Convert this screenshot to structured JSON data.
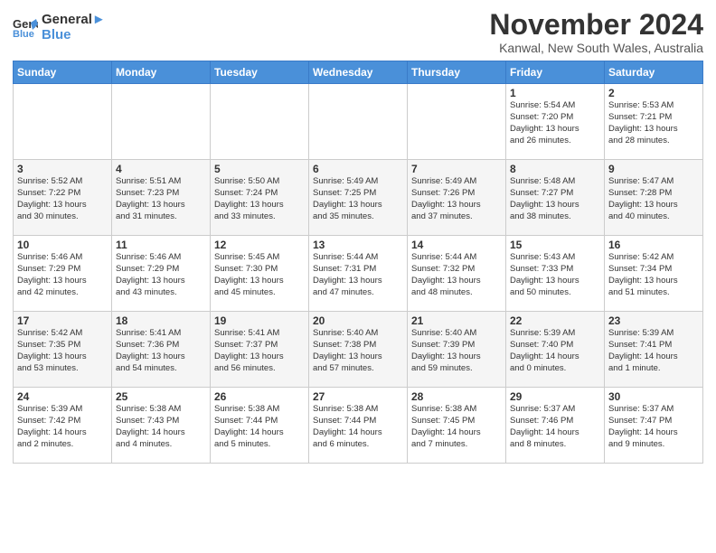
{
  "header": {
    "logo_line1": "General",
    "logo_line2": "Blue",
    "month_title": "November 2024",
    "location": "Kanwal, New South Wales, Australia"
  },
  "days_of_week": [
    "Sunday",
    "Monday",
    "Tuesday",
    "Wednesday",
    "Thursday",
    "Friday",
    "Saturday"
  ],
  "weeks": [
    [
      {
        "day": "",
        "info": ""
      },
      {
        "day": "",
        "info": ""
      },
      {
        "day": "",
        "info": ""
      },
      {
        "day": "",
        "info": ""
      },
      {
        "day": "",
        "info": ""
      },
      {
        "day": "1",
        "info": "Sunrise: 5:54 AM\nSunset: 7:20 PM\nDaylight: 13 hours\nand 26 minutes."
      },
      {
        "day": "2",
        "info": "Sunrise: 5:53 AM\nSunset: 7:21 PM\nDaylight: 13 hours\nand 28 minutes."
      }
    ],
    [
      {
        "day": "3",
        "info": "Sunrise: 5:52 AM\nSunset: 7:22 PM\nDaylight: 13 hours\nand 30 minutes."
      },
      {
        "day": "4",
        "info": "Sunrise: 5:51 AM\nSunset: 7:23 PM\nDaylight: 13 hours\nand 31 minutes."
      },
      {
        "day": "5",
        "info": "Sunrise: 5:50 AM\nSunset: 7:24 PM\nDaylight: 13 hours\nand 33 minutes."
      },
      {
        "day": "6",
        "info": "Sunrise: 5:49 AM\nSunset: 7:25 PM\nDaylight: 13 hours\nand 35 minutes."
      },
      {
        "day": "7",
        "info": "Sunrise: 5:49 AM\nSunset: 7:26 PM\nDaylight: 13 hours\nand 37 minutes."
      },
      {
        "day": "8",
        "info": "Sunrise: 5:48 AM\nSunset: 7:27 PM\nDaylight: 13 hours\nand 38 minutes."
      },
      {
        "day": "9",
        "info": "Sunrise: 5:47 AM\nSunset: 7:28 PM\nDaylight: 13 hours\nand 40 minutes."
      }
    ],
    [
      {
        "day": "10",
        "info": "Sunrise: 5:46 AM\nSunset: 7:29 PM\nDaylight: 13 hours\nand 42 minutes."
      },
      {
        "day": "11",
        "info": "Sunrise: 5:46 AM\nSunset: 7:29 PM\nDaylight: 13 hours\nand 43 minutes."
      },
      {
        "day": "12",
        "info": "Sunrise: 5:45 AM\nSunset: 7:30 PM\nDaylight: 13 hours\nand 45 minutes."
      },
      {
        "day": "13",
        "info": "Sunrise: 5:44 AM\nSunset: 7:31 PM\nDaylight: 13 hours\nand 47 minutes."
      },
      {
        "day": "14",
        "info": "Sunrise: 5:44 AM\nSunset: 7:32 PM\nDaylight: 13 hours\nand 48 minutes."
      },
      {
        "day": "15",
        "info": "Sunrise: 5:43 AM\nSunset: 7:33 PM\nDaylight: 13 hours\nand 50 minutes."
      },
      {
        "day": "16",
        "info": "Sunrise: 5:42 AM\nSunset: 7:34 PM\nDaylight: 13 hours\nand 51 minutes."
      }
    ],
    [
      {
        "day": "17",
        "info": "Sunrise: 5:42 AM\nSunset: 7:35 PM\nDaylight: 13 hours\nand 53 minutes."
      },
      {
        "day": "18",
        "info": "Sunrise: 5:41 AM\nSunset: 7:36 PM\nDaylight: 13 hours\nand 54 minutes."
      },
      {
        "day": "19",
        "info": "Sunrise: 5:41 AM\nSunset: 7:37 PM\nDaylight: 13 hours\nand 56 minutes."
      },
      {
        "day": "20",
        "info": "Sunrise: 5:40 AM\nSunset: 7:38 PM\nDaylight: 13 hours\nand 57 minutes."
      },
      {
        "day": "21",
        "info": "Sunrise: 5:40 AM\nSunset: 7:39 PM\nDaylight: 13 hours\nand 59 minutes."
      },
      {
        "day": "22",
        "info": "Sunrise: 5:39 AM\nSunset: 7:40 PM\nDaylight: 14 hours\nand 0 minutes."
      },
      {
        "day": "23",
        "info": "Sunrise: 5:39 AM\nSunset: 7:41 PM\nDaylight: 14 hours\nand 1 minute."
      }
    ],
    [
      {
        "day": "24",
        "info": "Sunrise: 5:39 AM\nSunset: 7:42 PM\nDaylight: 14 hours\nand 2 minutes."
      },
      {
        "day": "25",
        "info": "Sunrise: 5:38 AM\nSunset: 7:43 PM\nDaylight: 14 hours\nand 4 minutes."
      },
      {
        "day": "26",
        "info": "Sunrise: 5:38 AM\nSunset: 7:44 PM\nDaylight: 14 hours\nand 5 minutes."
      },
      {
        "day": "27",
        "info": "Sunrise: 5:38 AM\nSunset: 7:44 PM\nDaylight: 14 hours\nand 6 minutes."
      },
      {
        "day": "28",
        "info": "Sunrise: 5:38 AM\nSunset: 7:45 PM\nDaylight: 14 hours\nand 7 minutes."
      },
      {
        "day": "29",
        "info": "Sunrise: 5:37 AM\nSunset: 7:46 PM\nDaylight: 14 hours\nand 8 minutes."
      },
      {
        "day": "30",
        "info": "Sunrise: 5:37 AM\nSunset: 7:47 PM\nDaylight: 14 hours\nand 9 minutes."
      }
    ]
  ]
}
